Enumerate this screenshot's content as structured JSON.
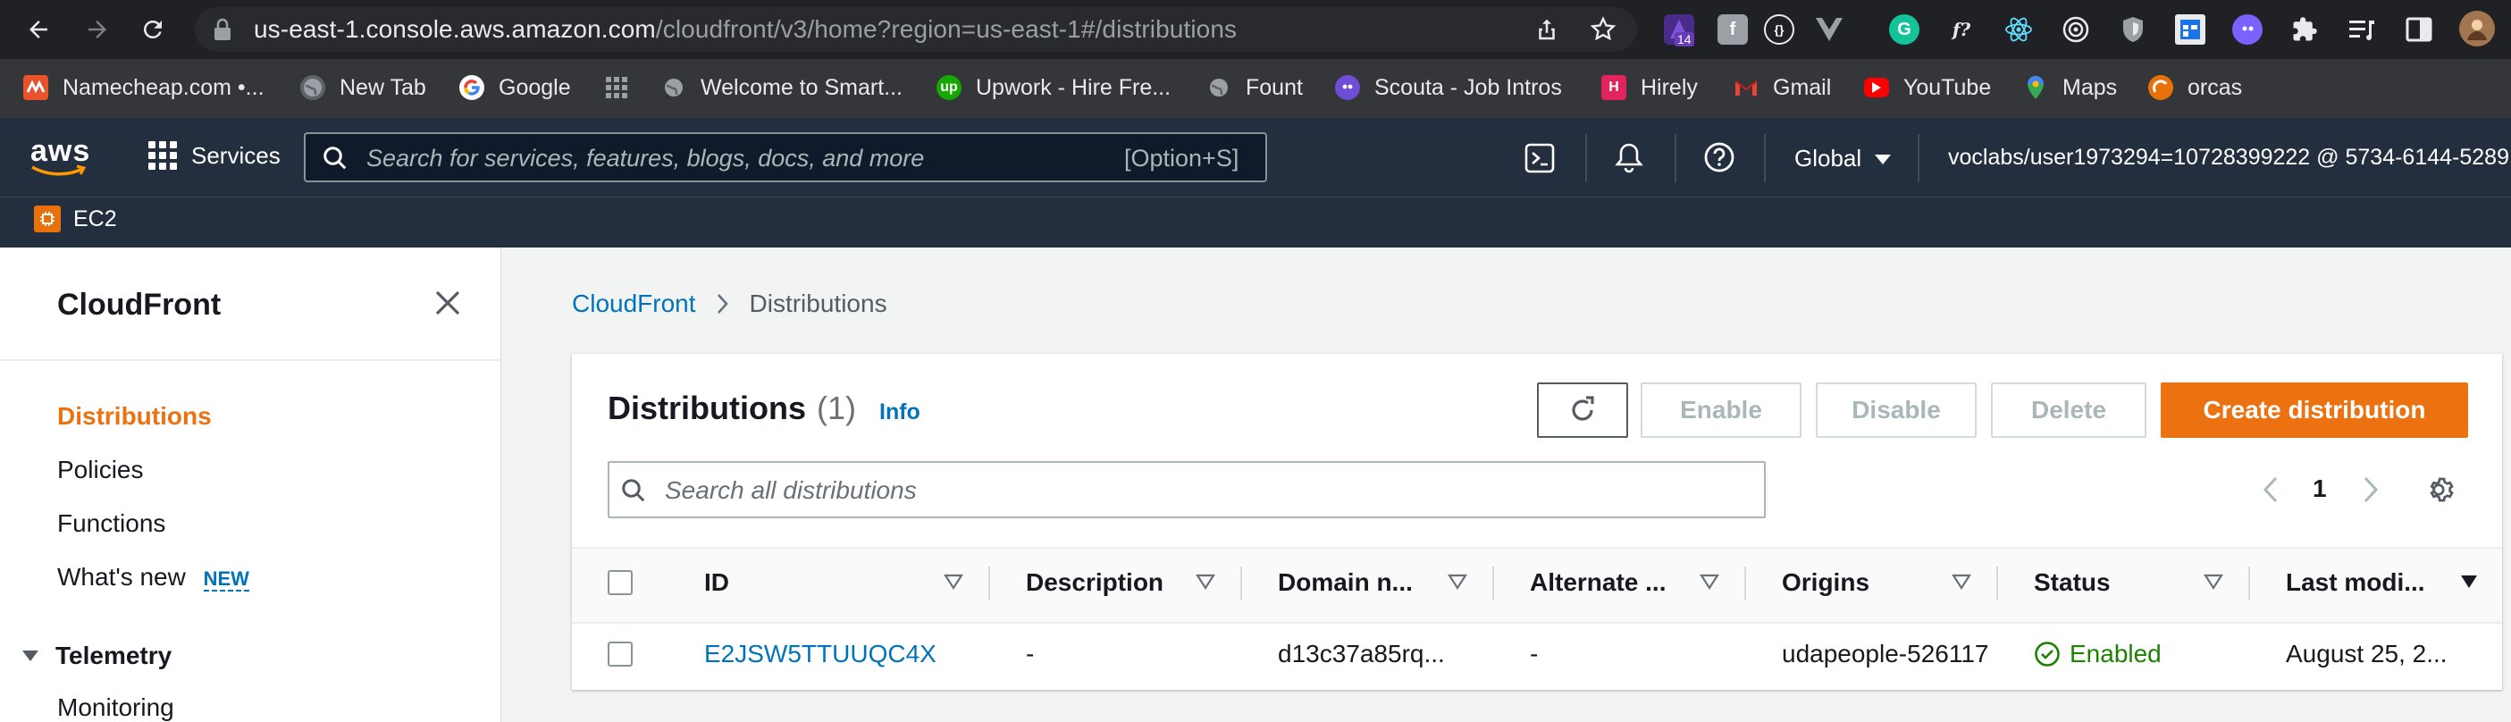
{
  "browser": {
    "url_host": "us-east-1.console.aws.amazon.com",
    "url_path": "/cloudfront/v3/home?region=us-east-1#/distributions",
    "extension_badge": "14",
    "bookmarks": [
      {
        "label": "Namecheap.com •...",
        "icon": "namecheap-icon",
        "color": "#e8532b"
      },
      {
        "label": "New Tab",
        "icon": "globe-icon",
        "color": "#5f6368"
      },
      {
        "label": "Google",
        "icon": "google-icon",
        "color": "#ffffff"
      },
      {
        "label": "",
        "icon": "apps-grid-icon",
        "color": "#9aa0a6"
      },
      {
        "label": "Welcome to Smart...",
        "icon": "globe-icon",
        "color": "#5f6368"
      },
      {
        "label": "Upwork - Hire Fre...",
        "icon": "upwork-icon",
        "color": "#14a800"
      },
      {
        "label": "Fount",
        "icon": "globe-icon",
        "color": "#5f6368"
      },
      {
        "label": "Scouta - Job Intros",
        "icon": "scouta-icon",
        "color": "#6e4dd8"
      },
      {
        "label": "Hirely",
        "icon": "hirely-icon",
        "color": "#e0245e"
      },
      {
        "label": "Gmail",
        "icon": "gmail-icon",
        "color": "#ffffff"
      },
      {
        "label": "YouTube",
        "icon": "youtube-icon",
        "color": "#ff0000"
      },
      {
        "label": "Maps",
        "icon": "maps-icon",
        "color": "#34a853"
      },
      {
        "label": "orcas",
        "icon": "orcas-icon",
        "color": "#e8710a"
      }
    ]
  },
  "aws": {
    "logo": "aws",
    "services_label": "Services",
    "search_placeholder": "Search for services, features, blogs, docs, and more",
    "search_shortcut": "[Option+S]",
    "region": "Global",
    "account": "voclabs/user1973294=10728399222 @ 5734-6144-5289",
    "favorite_service": "EC2",
    "brand_color": "#ec7211"
  },
  "sidebar": {
    "title": "CloudFront",
    "items": [
      {
        "label": "Distributions",
        "active": true
      },
      {
        "label": "Policies"
      },
      {
        "label": "Functions"
      },
      {
        "label": "What's new",
        "badge": "NEW"
      }
    ],
    "section": "Telemetry",
    "section_items": [
      {
        "label": "Monitoring"
      }
    ]
  },
  "breadcrumb": {
    "root": "CloudFront",
    "current": "Distributions"
  },
  "distributions": {
    "title": "Distributions",
    "count": "(1)",
    "info": "Info",
    "buttons": {
      "enable": "Enable",
      "disable": "Disable",
      "delete": "Delete",
      "create": "Create distribution"
    },
    "search_placeholder": "Search all distributions",
    "page": "1",
    "columns": [
      "ID",
      "Description",
      "Domain n...",
      "Alternate ...",
      "Origins",
      "Status",
      "Last modi..."
    ],
    "rows": [
      {
        "id": "E2JSW5TTUUQC4X",
        "description": "-",
        "domain": "d13c37a85rq...",
        "alternate": "-",
        "origins": "udapeople-526117",
        "status": "Enabled",
        "last_modified": "August 25, 2..."
      }
    ]
  }
}
